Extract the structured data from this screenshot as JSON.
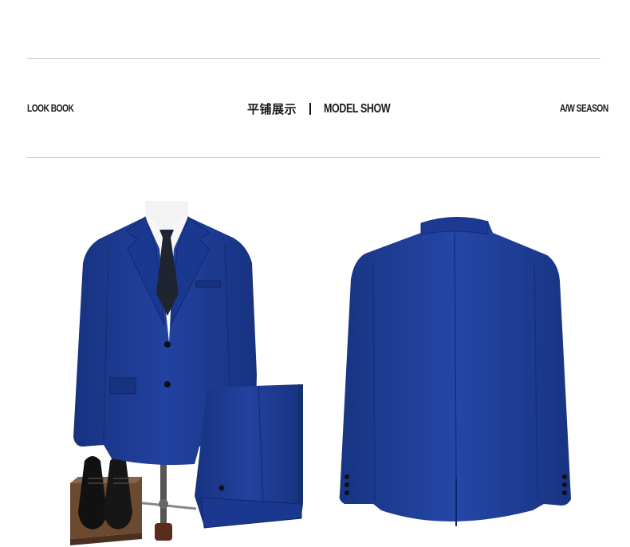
{
  "header": {
    "left_label": "LOOK BOOK",
    "center_cn": "平铺展示",
    "center_en": "MODEL SHOW",
    "right_label": "A/W SEASON"
  },
  "colors": {
    "suit_blue": "#1d3a8e",
    "suit_shadow": "#152c72",
    "rule": "#cfcfcf",
    "text": "#1a1a1a"
  },
  "images": {
    "front": "front-suit-with-trousers-and-shoes",
    "back": "back-of-suit-jacket"
  }
}
